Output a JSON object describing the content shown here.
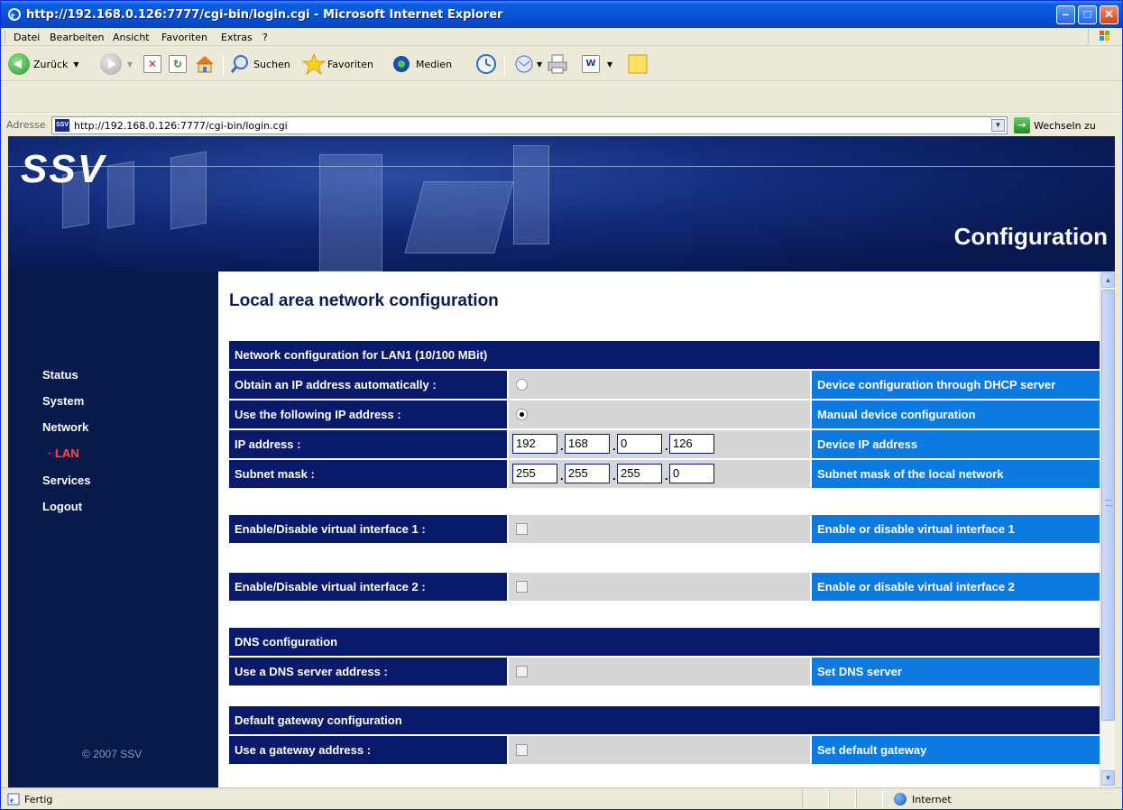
{
  "window": {
    "title": "http://192.168.0.126:7777/cgi-bin/login.cgi - Microsoft Internet Explorer"
  },
  "menu": {
    "items": [
      "Datei",
      "Bearbeiten",
      "Ansicht",
      "Favoriten",
      "Extras",
      "?"
    ]
  },
  "toolbar": {
    "back_label": "Zurück",
    "search_label": "Suchen",
    "favorites_label": "Favoriten",
    "media_label": "Medien"
  },
  "address": {
    "label": "Adresse",
    "favicon_text": "SSV",
    "url": "http://192.168.0.126:7777/cgi-bin/login.cgi",
    "go_label": "Wechseln zu"
  },
  "banner": {
    "logo": "SSV",
    "title": "Configuration"
  },
  "sidebar": {
    "items": [
      {
        "label": "Status"
      },
      {
        "label": "System"
      },
      {
        "label": "Network"
      },
      {
        "label": "· LAN"
      },
      {
        "label": "Services"
      },
      {
        "label": "Logout"
      }
    ],
    "copyright": "© 2007 SSV"
  },
  "content": {
    "heading": "Local area network configuration",
    "lan_header": "Network configuration for LAN1 (10/100 MBit)",
    "rows": {
      "dhcp": {
        "label": "Obtain an IP address automatically :",
        "desc": "Device configuration through DHCP server"
      },
      "manual": {
        "label": "Use the following IP address :",
        "desc": "Manual device configuration"
      },
      "ip": {
        "label": "IP address :",
        "desc": "Device IP address",
        "octets": [
          "192",
          "168",
          "0",
          "126"
        ]
      },
      "mask": {
        "label": "Subnet mask :",
        "desc": "Subnet mask of the local network",
        "octets": [
          "255",
          "255",
          "255",
          "0"
        ]
      },
      "vif1": {
        "label": "Enable/Disable virtual interface 1 :",
        "desc": "Enable or disable virtual interface 1"
      },
      "vif2": {
        "label": "Enable/Disable virtual interface 2 :",
        "desc": "Enable or disable virtual interface 2"
      },
      "dns": {
        "label": "Use a DNS server address :",
        "desc": "Set DNS server"
      },
      "gateway": {
        "label": "Use a gateway address :",
        "desc": "Set default gateway"
      }
    },
    "dns_header": "DNS configuration",
    "gateway_header": "Default gateway configuration"
  },
  "status": {
    "text": "Fertig",
    "zone": "Internet"
  },
  "colors": {
    "nav_dark": "#0a1a6a",
    "desc_blue": "#0c7ae0",
    "sub_nav_red": "#ff4a4a"
  }
}
